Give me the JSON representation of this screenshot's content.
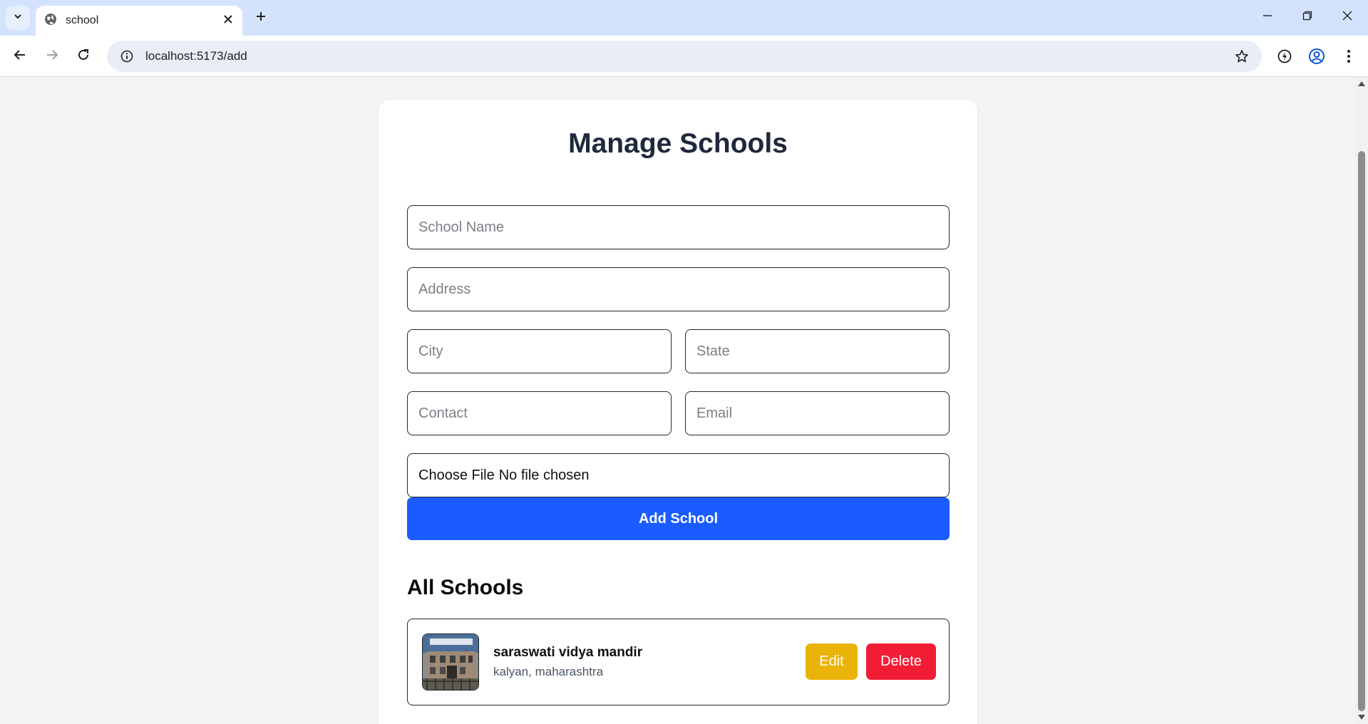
{
  "browser": {
    "tab_title": "school",
    "url": "localhost:5173/add",
    "icons": {
      "tab_menu": "chevron-down-icon",
      "favicon": "globe-icon",
      "tab_close": "close-icon",
      "new_tab": "plus-icon",
      "back": "arrow-left-icon",
      "forward": "arrow-right-icon",
      "reload": "reload-icon",
      "site_info": "info-icon",
      "bookmark": "star-icon",
      "extensions": "performance-icon",
      "profile": "profile-icon",
      "menu": "kebab-menu-icon"
    }
  },
  "page": {
    "title": "Manage Schools",
    "form": {
      "school_name_placeholder": "School Name",
      "address_placeholder": "Address",
      "city_placeholder": "City",
      "state_placeholder": "State",
      "contact_placeholder": "Contact",
      "email_placeholder": "Email",
      "file_button_label": "Choose File",
      "file_status": "No file chosen",
      "submit_label": "Add School"
    },
    "list": {
      "title": "All Schools",
      "schools": [
        {
          "name": "saraswati vidya mandir",
          "location": "kalyan, maharashtra",
          "edit_label": "Edit",
          "delete_label": "Delete"
        }
      ]
    }
  },
  "colors": {
    "primary_button": "#1a5cff",
    "edit_button": "#eab308",
    "delete_button": "#f21d35",
    "page_background": "#f3f4f6",
    "title_text": "#1e293b"
  }
}
